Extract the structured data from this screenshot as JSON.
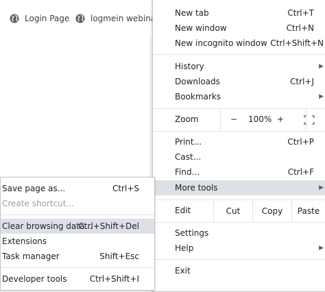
{
  "bookmarks": [
    {
      "label": "Login Page",
      "icon": "globe-icon"
    },
    {
      "label": "logmein webinar",
      "icon": "globe-icon"
    }
  ],
  "menu": {
    "new_tab": {
      "label": "New tab",
      "shortcut": "Ctrl+T"
    },
    "new_window": {
      "label": "New window",
      "shortcut": "Ctrl+N"
    },
    "new_incognito": {
      "label": "New incognito window",
      "shortcut": "Ctrl+Shift+N"
    },
    "history": {
      "label": "History"
    },
    "downloads": {
      "label": "Downloads",
      "shortcut": "Ctrl+J"
    },
    "bookmarks": {
      "label": "Bookmarks"
    },
    "zoom": {
      "label": "Zoom",
      "minus": "−",
      "value": "100%",
      "plus": "+",
      "fullscreen_icon": "fullscreen-icon"
    },
    "print": {
      "label": "Print...",
      "shortcut": "Ctrl+P"
    },
    "cast": {
      "label": "Cast..."
    },
    "find": {
      "label": "Find...",
      "shortcut": "Ctrl+F"
    },
    "more_tools": {
      "label": "More tools"
    },
    "edit": {
      "label": "Edit",
      "cut": "Cut",
      "copy": "Copy",
      "paste": "Paste"
    },
    "settings": {
      "label": "Settings"
    },
    "help": {
      "label": "Help"
    },
    "exit": {
      "label": "Exit"
    }
  },
  "submenu": {
    "save_page": {
      "label": "Save page as...",
      "shortcut": "Ctrl+S"
    },
    "create_shortcut": {
      "label": "Create shortcut..."
    },
    "clear_browsing": {
      "label": "Clear browsing data...",
      "shortcut": "Ctrl+Shift+Del"
    },
    "extensions": {
      "label": "Extensions"
    },
    "task_manager": {
      "label": "Task manager",
      "shortcut": "Shift+Esc"
    },
    "developer_tools": {
      "label": "Developer tools",
      "shortcut": "Ctrl+Shift+I"
    }
  },
  "colors": {
    "highlight": "#dde1e7",
    "separator": "#e3e3e3",
    "disabled_text": "#9aa0a6"
  }
}
